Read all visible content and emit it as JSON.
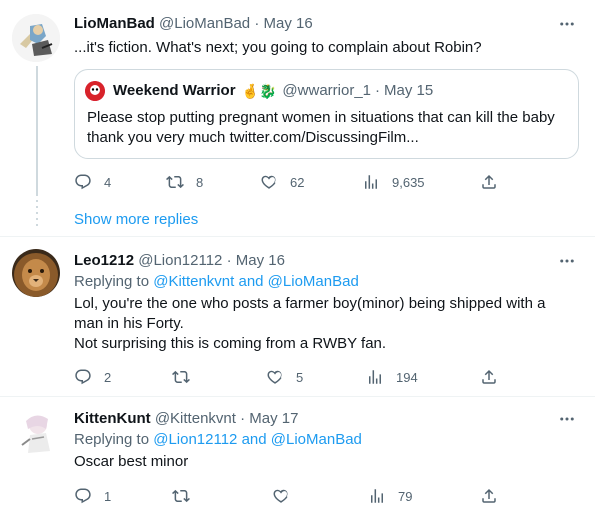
{
  "tweet1": {
    "name": "LioManBad",
    "handle": "@LioManBad",
    "separator": "·",
    "date": "May 16",
    "text": "...it's fiction. What's next; you going to complain about Robin?",
    "quote": {
      "name": "Weekend Warrior",
      "emoji": "🤞🐉",
      "handle": "@wwarrior_1",
      "separator": "·",
      "date": "May 15",
      "text": "Please stop putting pregnant women in situations that can kill the baby thank you very much twitter.com/DiscussingFilm..."
    },
    "actions": {
      "replies": "4",
      "retweets": "8",
      "likes": "62",
      "views": "9,635"
    }
  },
  "show_more": "Show more replies",
  "tweet2": {
    "name": "Leo1212",
    "handle": "@Lion12112",
    "separator": "·",
    "date": "May 16",
    "replying_prefix": "Replying to",
    "replying_targets": "@Kittenkvnt and @LioManBad",
    "lines": [
      "Lol, you're the one who posts a farmer boy(minor) being shipped with a",
      "man in his Forty.",
      "Not surprising this is coming from a RWBY fan."
    ],
    "actions": {
      "replies": "2",
      "retweets": "",
      "likes": "5",
      "views": "194"
    }
  },
  "tweet3": {
    "name": "KittenKunt",
    "handle": "@Kittenkvnt",
    "separator": "·",
    "date": "May 17",
    "replying_prefix": "Replying to",
    "replying_targets": "@Lion12112 and @LioManBad",
    "text": "Oscar best minor",
    "actions": {
      "replies": "1",
      "retweets": "",
      "likes": "",
      "views": "79"
    }
  },
  "icons": [
    "more-icon",
    "reply-icon",
    "retweet-icon",
    "like-icon",
    "views-icon",
    "share-icon"
  ],
  "colors": {
    "link": "#1d9bf0",
    "muted": "#536471",
    "border": "#cfd9de"
  }
}
